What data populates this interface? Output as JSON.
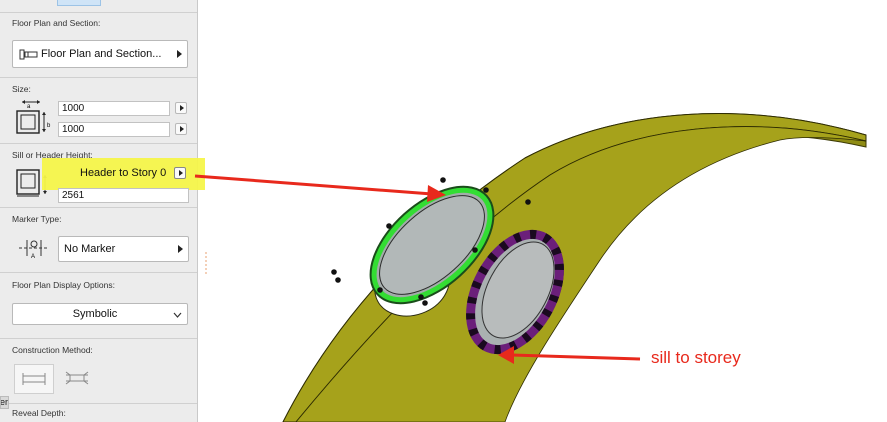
{
  "panel": {
    "floor_plan_label": "Floor Plan and Section:",
    "floor_plan_value": "Floor Plan and Section...",
    "size_label": "Size:",
    "width_value": "1000",
    "height_value": "1000",
    "sill_label": "Sill or Header Height:",
    "sill_mode": "Header to Story 0",
    "sill_value": "2561",
    "marker_label": "Marker Type:",
    "marker_value": "No Marker",
    "display_label": "Floor Plan Display Options:",
    "display_value": "Symbolic",
    "construction_label": "Construction Method:",
    "reveal_label": "Reveal Depth:",
    "bottom_tab": "er"
  },
  "annotation": {
    "sill_text": "sill to storey",
    "arrow_color": "#e8291c",
    "highlight_color": "#f6f64a"
  },
  "colors": {
    "wall": "#a4a01a",
    "selected_ring": "#33dd33",
    "purple_ring": "#6b1f7a",
    "glass": "#aab1b1"
  }
}
